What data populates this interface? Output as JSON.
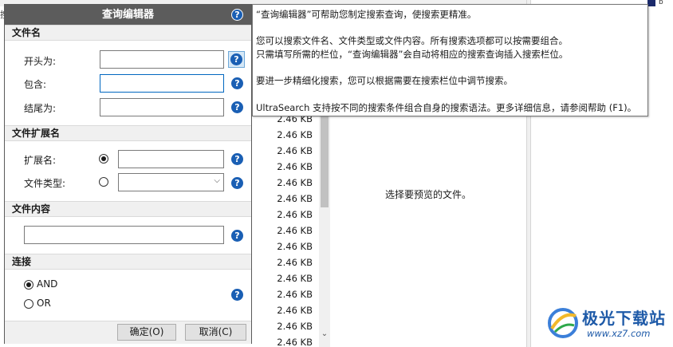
{
  "dialog": {
    "title": "查询编辑器",
    "help_glyph": "?",
    "sections": {
      "filename": "文件名",
      "extension": "文件扩展名",
      "content": "文件内容",
      "connect": "连接"
    },
    "labels": {
      "starts_with": "开头为:",
      "contains": "包含:",
      "ends_with": "结尾为:",
      "extension": "扩展名:",
      "file_type": "文件类型:"
    },
    "inputs": {
      "starts_with": "",
      "contains": "",
      "ends_with": "",
      "extension": "",
      "file_type": "",
      "content": ""
    },
    "options": {
      "and": "AND",
      "or": "OR",
      "selected": "AND"
    },
    "buttons": {
      "ok": "确定(O)",
      "cancel": "取消(C)"
    }
  },
  "tooltip": {
    "lines": [
      "“查询编辑器”可帮助您制定搜索查询，使搜索更精准。",
      "您可以搜索文件名、文件类型或文件内容。所有搜索选项都可以按需要组合。",
      "只需填写所需的栏位，“查询编辑器”会自动将相应的搜索查询插入搜索栏位。",
      "要进一步精细化搜索，您可以根据需要在搜索栏位中调节搜索。",
      "UltraSearch 支持按不同的搜索条件组合自身的搜索语法。更多详细信息，请参阅帮助 (F1)。"
    ]
  },
  "background": {
    "left_fragment": "搜",
    "file_sizes": [
      "2.46 KB",
      "2.46 KB",
      "2.46 KB",
      "2.46 KB",
      "2.46 KB",
      "2.46 KB",
      "2.46 KB",
      "2.46 KB",
      "2.46 KB",
      "2.46 KB",
      "2.46 KB",
      "2.46 KB",
      "2.46 KB",
      "2.46 KB",
      "2.46 KB"
    ],
    "preview_message": "选择要预览的文件。",
    "toolbar_fragment": "b"
  },
  "watermark": {
    "site_name": "极光下载站",
    "url": "www.xz7.com"
  },
  "colors": {
    "title_bar": "#5c5c5c",
    "help_icon": "#1a5fb4",
    "focus_border": "#0067c0",
    "watermark": "#1e5aa8"
  }
}
